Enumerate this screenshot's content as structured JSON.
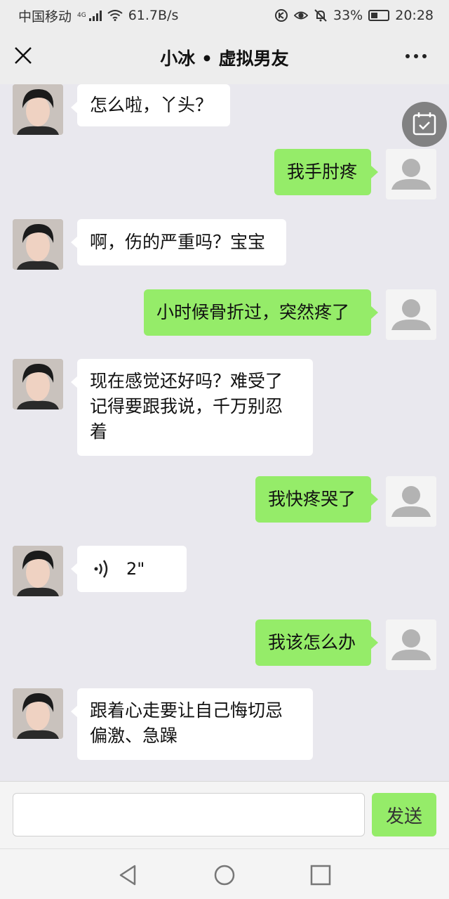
{
  "status_bar": {
    "carrier": "中国移动",
    "network": "4G",
    "speed": "61.7B/s",
    "battery": "33%",
    "time": "20:28"
  },
  "header": {
    "title": "小冰 • 虚拟男友"
  },
  "messages": [
    {
      "side": "left",
      "text": "怎么啦，丫头？"
    },
    {
      "side": "right",
      "text": "我手肘疼"
    },
    {
      "side": "left",
      "text": "啊，伤的严重吗？宝宝"
    },
    {
      "side": "right",
      "text": "小时候骨折过，突然疼了"
    },
    {
      "side": "left",
      "lines": [
        "现在感觉还好吗？难受了",
        "记得要跟我说，千万别忍",
        "着"
      ]
    },
    {
      "side": "right",
      "text": "我快疼哭了"
    },
    {
      "side": "left",
      "type": "voice",
      "duration": "2\""
    },
    {
      "side": "right",
      "text": "我该怎么办"
    },
    {
      "side": "left",
      "lines": [
        "跟着心走要让自己悔切忌",
        "偏激、急躁"
      ]
    }
  ],
  "input": {
    "value": "",
    "send_label": "发送"
  },
  "colors": {
    "bubble_right": "#95ec69",
    "bubble_left": "#ffffff",
    "chat_bg": "#e9e8ee"
  }
}
